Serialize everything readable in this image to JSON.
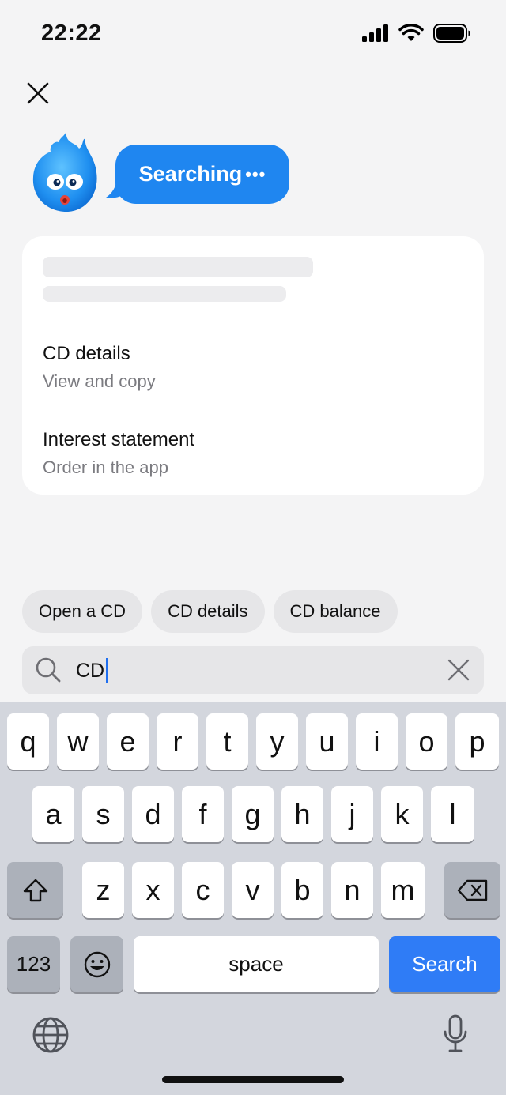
{
  "status": {
    "time": "22:22"
  },
  "assistant": {
    "bubble_text": "Searching",
    "bubble_dots": "•••"
  },
  "results": [
    {
      "title": "CD details",
      "subtitle": "View and copy"
    },
    {
      "title": "Interest statement",
      "subtitle": "Order in the app"
    }
  ],
  "suggestions": [
    "Open a CD",
    "CD details",
    "CD balance"
  ],
  "search": {
    "value": "CD"
  },
  "keyboard": {
    "row1": [
      "q",
      "w",
      "e",
      "r",
      "t",
      "y",
      "u",
      "i",
      "o",
      "p"
    ],
    "row2": [
      "a",
      "s",
      "d",
      "f",
      "g",
      "h",
      "j",
      "k",
      "l"
    ],
    "row3": [
      "z",
      "x",
      "c",
      "v",
      "b",
      "n",
      "m"
    ],
    "numbers_label": "123",
    "space_label": "space",
    "action_label": "Search"
  },
  "colors": {
    "accent": "#1f86f0",
    "search_key": "#2f7cf6",
    "background": "#f4f4f5"
  }
}
